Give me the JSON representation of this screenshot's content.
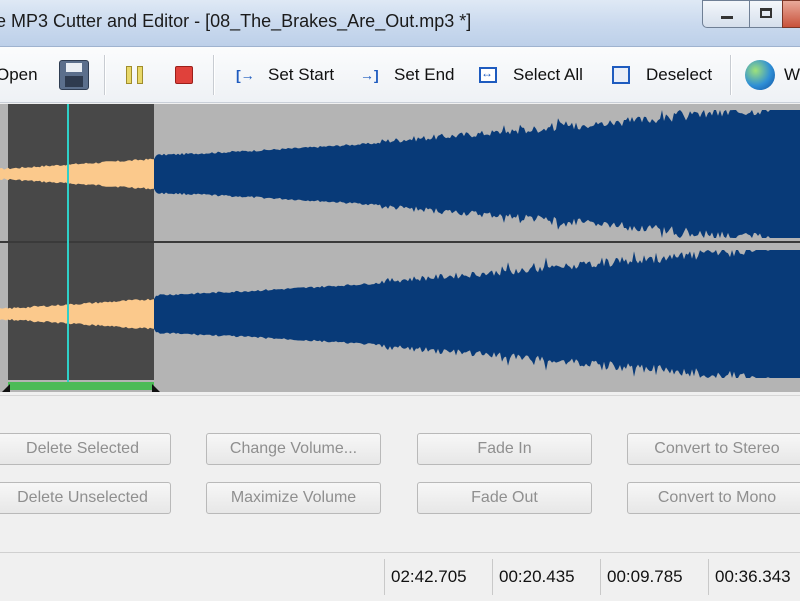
{
  "window": {
    "title": "e MP3 Cutter and Editor - [08_The_Brakes_Are_Out.mp3 *]"
  },
  "toolbar": {
    "open_label": "Open",
    "set_start_label": "Set Start",
    "set_end_label": "Set End",
    "select_all_label": "Select All",
    "deselect_label": "Deselect",
    "web_label": "W"
  },
  "waveform": {
    "colors": {
      "background": "#b4b4b4",
      "selection_bg": "#484848",
      "wave": "#083a78",
      "selected_wave": "#fbc98c",
      "cursor": "#2fd0c8",
      "range_bar": "#4cbb57"
    }
  },
  "actions": {
    "delete_selected": "Delete Selected",
    "delete_unselected": "Delete Unselected",
    "change_volume": "Change Volume...",
    "maximize_volume": "Maximize Volume",
    "fade_in": "Fade In",
    "fade_out": "Fade Out",
    "convert_stereo": "Convert to Stereo",
    "convert_mono": "Convert to Mono"
  },
  "status": {
    "total": "02:42.705",
    "cursor": "00:20.435",
    "selection": "00:09.785",
    "end": "00:36.343"
  }
}
